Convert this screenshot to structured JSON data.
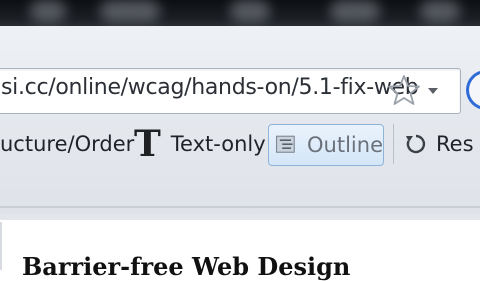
{
  "address_bar": {
    "url": "si.cc/online/wcag/hands-on/5.1-fix-web",
    "star_icon": "star-icon",
    "dropdown_icon": "chevron-down-icon"
  },
  "toolbar": {
    "structure_order_label": "ucture/Order",
    "text_only_label": "Text-only",
    "text_only_icon_glyph": "T",
    "outline_label": "Outline",
    "reset_label": "Res",
    "colors": {
      "outline_active_bg": "#d4e6f8",
      "outline_active_border": "#8fb3d9"
    }
  },
  "page": {
    "heading": "Barrier-free Web Design"
  },
  "colors": {
    "accent": "#2e6bd6",
    "chrome": "#e5e9ee",
    "text": "#1f2228"
  }
}
